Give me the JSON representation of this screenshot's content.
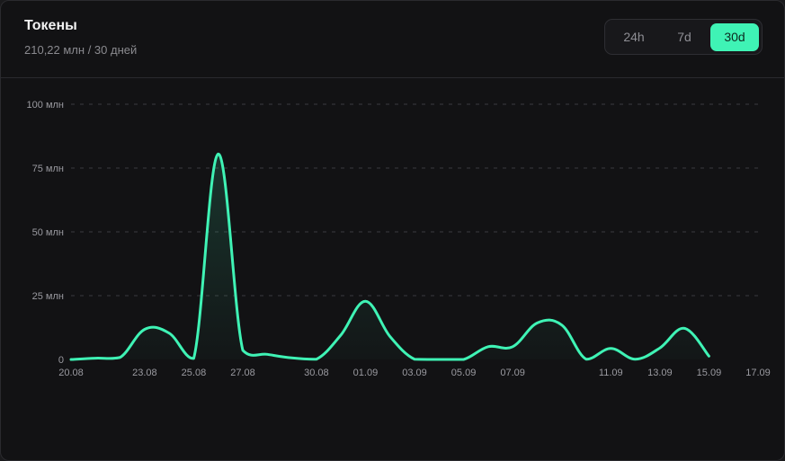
{
  "header": {
    "title": "Токены",
    "subtitle": "210,22 млн / 30 дней"
  },
  "range_selector": {
    "options": [
      "24h",
      "7d",
      "30d"
    ],
    "active": "30d"
  },
  "colors": {
    "accent": "#3ff3b5",
    "background": "#121214",
    "grid": "#3a3a3f"
  },
  "chart_data": {
    "type": "area",
    "title": "",
    "xlabel": "",
    "ylabel": "",
    "ylim": [
      0,
      100
    ],
    "y_ticks": [
      {
        "value": 0,
        "label": "0"
      },
      {
        "value": 25,
        "label": "25 млн"
      },
      {
        "value": 50,
        "label": "50 млн"
      },
      {
        "value": 75,
        "label": "75 млн"
      },
      {
        "value": 100,
        "label": "100 млн"
      }
    ],
    "x_tick_labels": [
      "20.08",
      "23.08",
      "25.08",
      "27.08",
      "30.08",
      "01.09",
      "03.09",
      "05.09",
      "07.09",
      "11.09",
      "13.09",
      "15.09",
      "17.09"
    ],
    "x": [
      "20.08",
      "21.08",
      "22.08",
      "23.08",
      "24.08",
      "25.08",
      "26.08",
      "27.08",
      "28.08",
      "29.08",
      "30.08",
      "31.08",
      "01.09",
      "02.09",
      "03.09",
      "04.09",
      "05.09",
      "06.09",
      "07.09",
      "08.09",
      "09.09",
      "10.09",
      "11.09",
      "12.09",
      "13.09",
      "14.09",
      "15.09",
      "16.09",
      "17.09"
    ],
    "series": [
      {
        "values": [
          0,
          0.5,
          0.8,
          11.8,
          10.3,
          0.4,
          80.5,
          3.6,
          2.0,
          0.6,
          0.1,
          9.6,
          22.8,
          9.0,
          0.1,
          0,
          0,
          5.0,
          5.0,
          14.3,
          13.5,
          0.1,
          4.3,
          0.1,
          4.5,
          12.2,
          1.3
        ]
      }
    ],
    "grid": true,
    "legend": "none"
  }
}
